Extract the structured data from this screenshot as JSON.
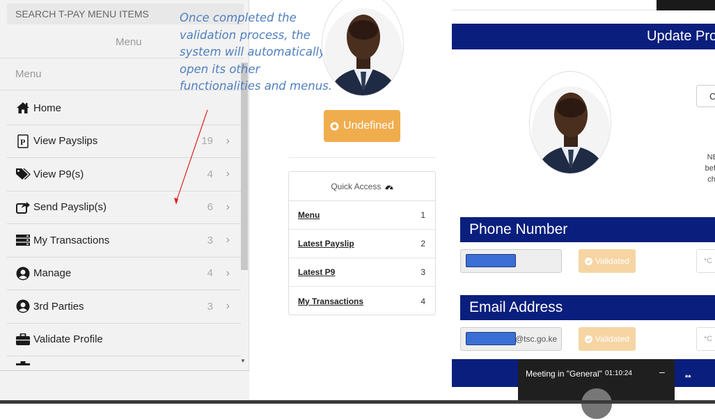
{
  "sidebar": {
    "search_placeholder": "SEARCH T-PAY MENU ITEMS",
    "menu_header": "Menu",
    "menu_sub": "Menu",
    "items": [
      {
        "label": "Home",
        "icon": "home-icon",
        "count": "",
        "chevron": ""
      },
      {
        "label": "View Payslips",
        "icon": "payslip-icon",
        "count": "19",
        "chevron": "›"
      },
      {
        "label": "View P9(s)",
        "icon": "tags-icon",
        "count": "4",
        "chevron": "›"
      },
      {
        "label": "Send Payslip(s)",
        "icon": "share-icon",
        "count": "6",
        "chevron": "›"
      },
      {
        "label": "My Transactions",
        "icon": "server-icon",
        "count": "3",
        "chevron": "›"
      },
      {
        "label": "Manage",
        "icon": "user-circle-icon",
        "count": "4",
        "chevron": "›"
      },
      {
        "label": "3rd Parties",
        "icon": "user-circle-icon",
        "count": "3",
        "chevron": "›"
      },
      {
        "label": "Validate Profile",
        "icon": "briefcase-icon",
        "count": "",
        "chevron": ""
      }
    ]
  },
  "annotation": {
    "text": "Once completed the validation process, the system will automatically open its other functionalities and menus."
  },
  "middle": {
    "status_button": "Undefined",
    "quick_access": {
      "title": "Quick Access",
      "rows": [
        {
          "label": "Menu",
          "num": "1"
        },
        {
          "label": "Latest Payslip",
          "num": "2"
        },
        {
          "label": "Latest P9",
          "num": "3"
        },
        {
          "label": "My Transactions",
          "num": "4"
        }
      ]
    }
  },
  "right": {
    "update_title": "Update Pro",
    "c_button": "C",
    "nb_lines": [
      "NB:",
      "befo",
      "cha"
    ],
    "phone": {
      "title": "Phone Number",
      "validated": "Validated",
      "right_field": "*C"
    },
    "email": {
      "title": "Email Address",
      "suffix": "@tsc.go.ke",
      "validated": "Validated",
      "right_field": "*C"
    }
  },
  "meeting": {
    "title": "Meeting in \"General\"",
    "time": "01:10:24",
    "minimize": "–",
    "dots": "**"
  },
  "colors": {
    "navy": "#0a1e7d",
    "warning": "#f0ad4e",
    "annotation": "#4f7fbf"
  }
}
